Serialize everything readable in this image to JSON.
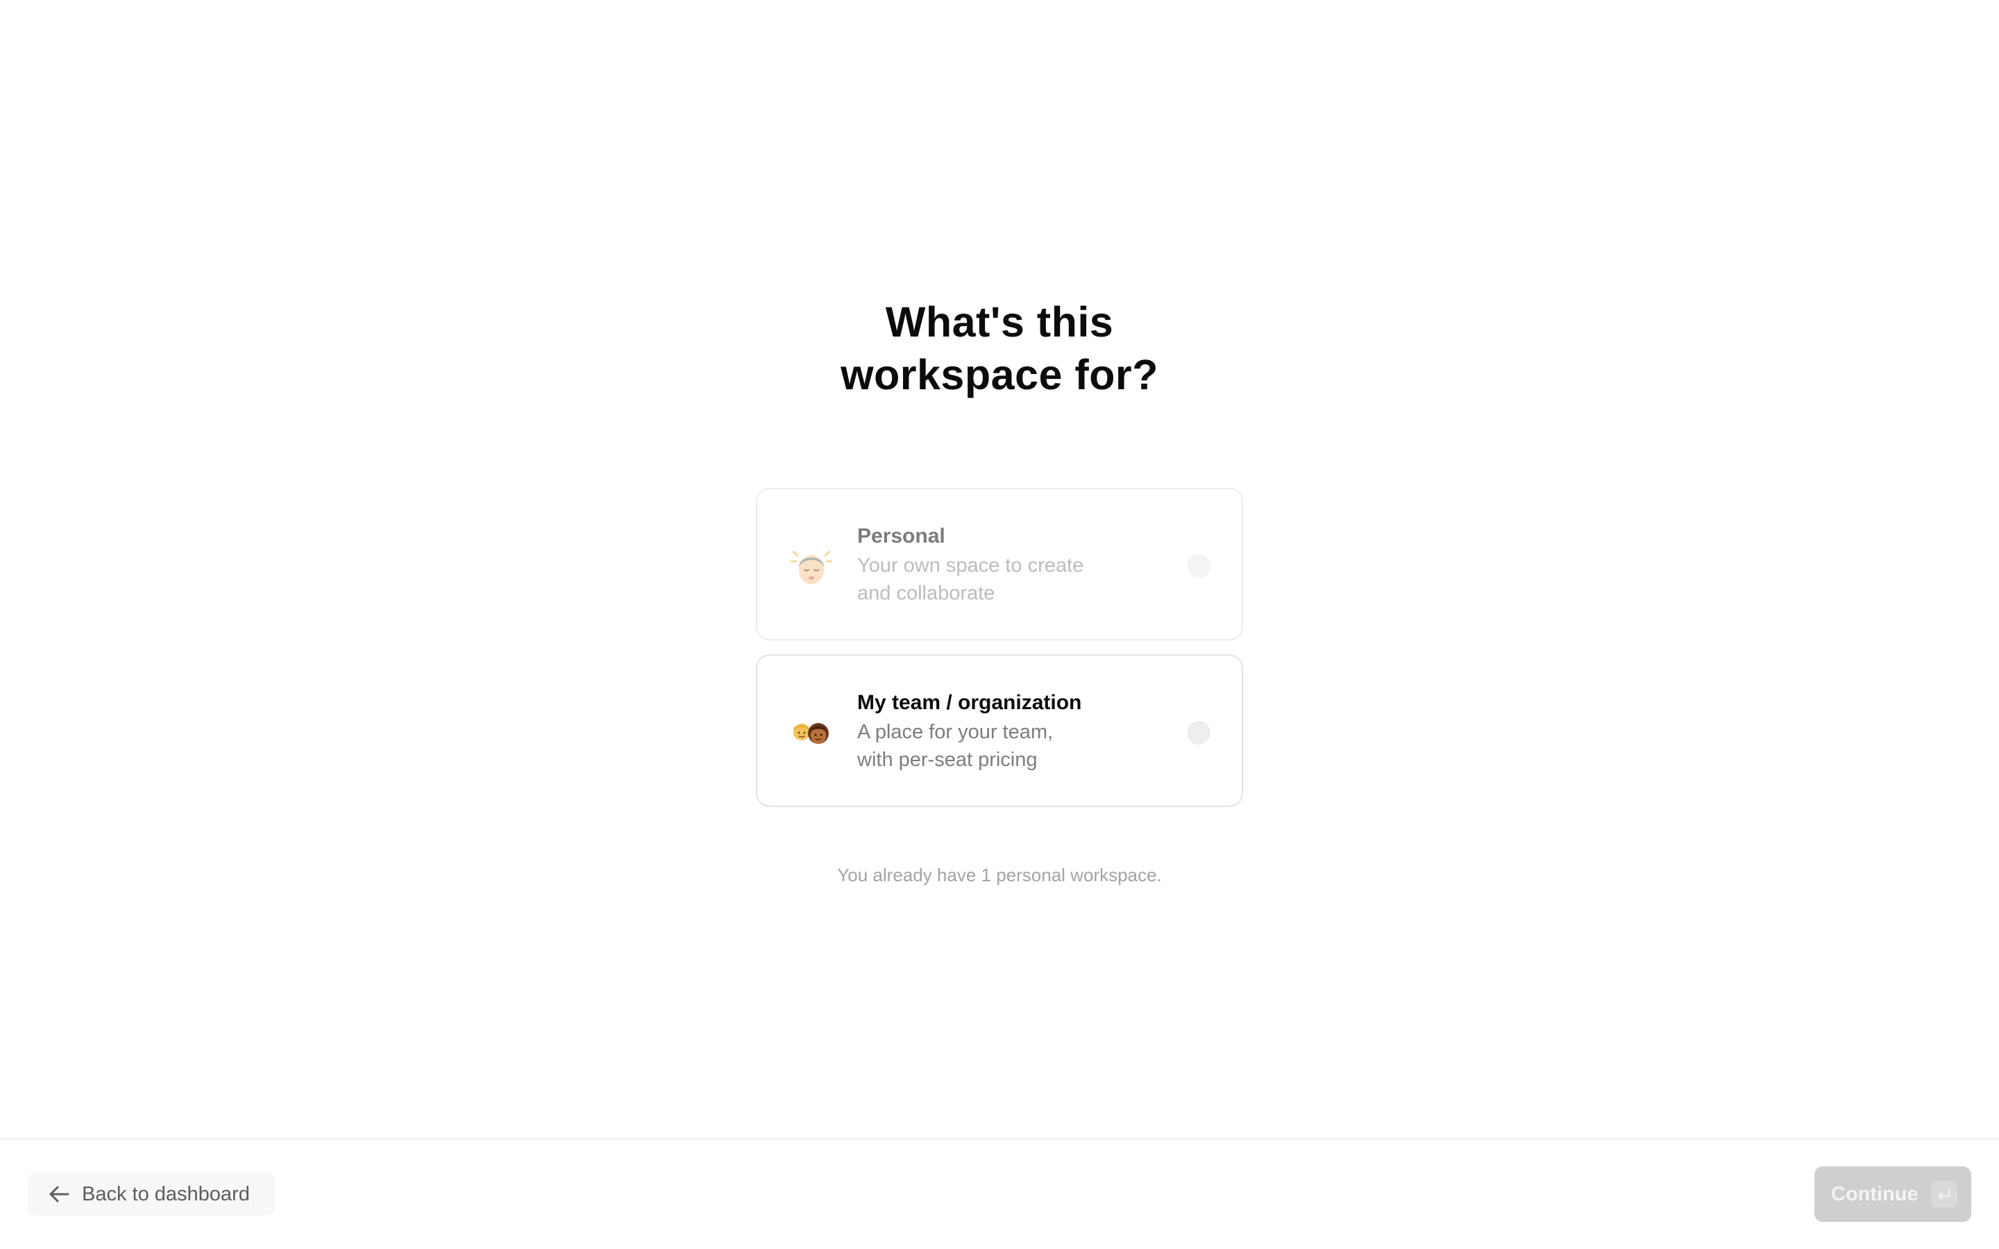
{
  "heading": {
    "line1": "What's this",
    "line2": "workspace for?"
  },
  "options": [
    {
      "id": "personal",
      "icon": "person-emoji-icon",
      "title": "Personal",
      "description_line1": "Your own space to create",
      "description_line2": "and collaborate",
      "selected": false,
      "disabled": true
    },
    {
      "id": "team",
      "icon": "team-emoji-icon",
      "title": "My team / organization",
      "description_line1": "A place for your team,",
      "description_line2": "with per-seat pricing",
      "selected": false,
      "disabled": false
    }
  ],
  "note": "You already have 1 personal workspace.",
  "footer": {
    "back_label": "Back to dashboard",
    "back_icon": "arrow-left-icon",
    "continue_label": "Continue",
    "continue_icon": "enter-key-icon",
    "continue_disabled": true
  }
}
